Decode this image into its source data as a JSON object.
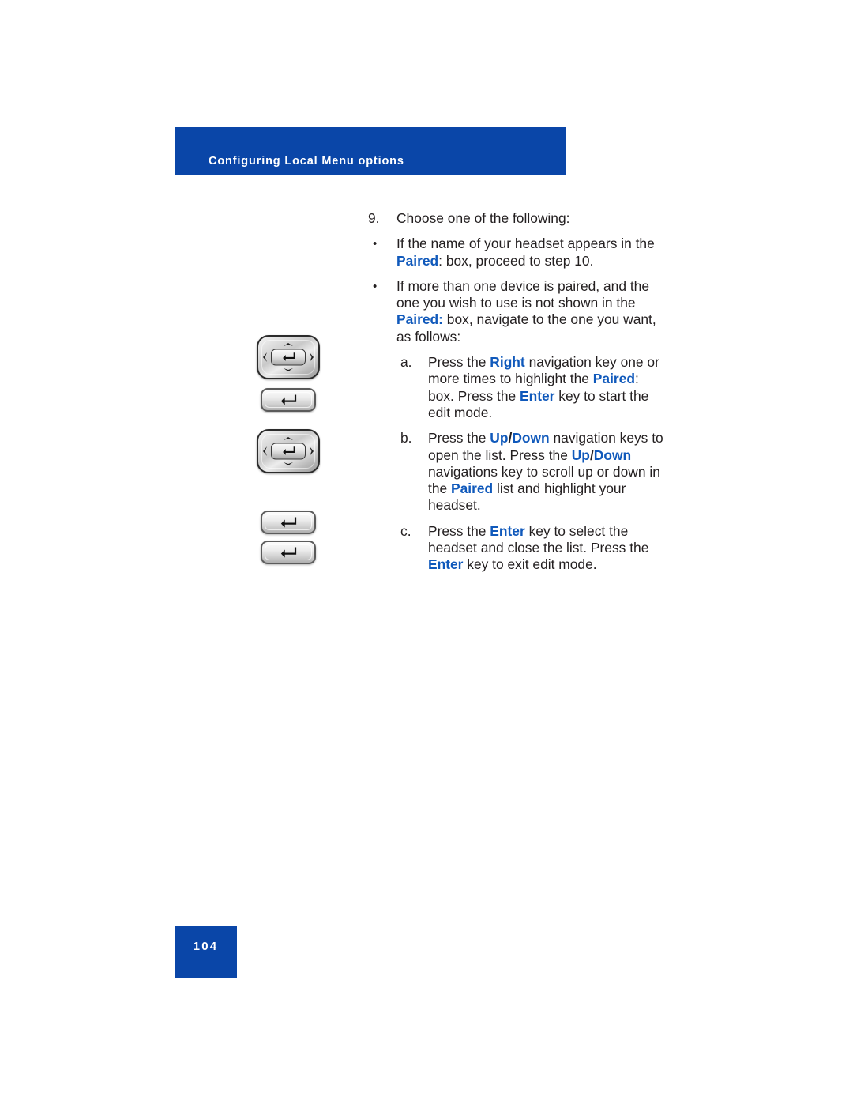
{
  "header": {
    "title": "Configuring Local Menu options",
    "banner_color": "#0a46a8"
  },
  "accent_color": "#1059bb",
  "content": {
    "step": {
      "marker": "9.",
      "text": "Choose one of the following:"
    },
    "bullets": [
      {
        "marker": "•",
        "parts": [
          {
            "t": "If the name of your headset appears in the ",
            "s": "plain"
          },
          {
            "t": "Paired",
            "s": "kw"
          },
          {
            "t": ": box, proceed to step 10.",
            "s": "plain"
          }
        ]
      },
      {
        "marker": "•",
        "parts": [
          {
            "t": "If more than one device is paired, and the one you wish to use is not shown in the ",
            "s": "plain"
          },
          {
            "t": "Paired:",
            "s": "kw"
          },
          {
            "t": " box, navigate to the one you want, as follows:",
            "s": "plain"
          }
        ]
      }
    ],
    "substeps": [
      {
        "marker": "a.",
        "parts": [
          {
            "t": "Press the ",
            "s": "plain"
          },
          {
            "t": "Right",
            "s": "kw"
          },
          {
            "t": " navigation key one or more times to highlight the ",
            "s": "plain"
          },
          {
            "t": "Paired",
            "s": "kw"
          },
          {
            "t": ": box. Press the ",
            "s": "plain"
          },
          {
            "t": "Enter",
            "s": "kw"
          },
          {
            "t": " key to start the edit mode.",
            "s": "plain"
          }
        ]
      },
      {
        "marker": "b.",
        "parts": [
          {
            "t": "Press the ",
            "s": "plain"
          },
          {
            "t": "Up",
            "s": "kw"
          },
          {
            "t": "/",
            "s": "kwplain"
          },
          {
            "t": "Down",
            "s": "kw"
          },
          {
            "t": " navigation keys to open the list. Press the ",
            "s": "plain"
          },
          {
            "t": "Up",
            "s": "kw"
          },
          {
            "t": "/",
            "s": "kwplain"
          },
          {
            "t": "Down",
            "s": "kw"
          },
          {
            "t": " navigations key to scroll up or down in the ",
            "s": "plain"
          },
          {
            "t": "Paired",
            "s": "kw"
          },
          {
            "t": " list and highlight your headset.",
            "s": "plain"
          }
        ]
      },
      {
        "marker": "c.",
        "parts": [
          {
            "t": "Press the ",
            "s": "plain"
          },
          {
            "t": "Enter",
            "s": "kw"
          },
          {
            "t": " key to select the headset and close the list. Press the ",
            "s": "plain"
          },
          {
            "t": "Enter",
            "s": "kw"
          },
          {
            "t": " key to exit edit mode.",
            "s": "plain"
          }
        ]
      }
    ]
  },
  "keys": [
    {
      "type": "navigation-cluster",
      "name": "navigation-key-cluster-a"
    },
    {
      "type": "enter-key",
      "name": "enter-key-a"
    },
    {
      "type": "navigation-cluster",
      "name": "navigation-key-cluster-b"
    },
    {
      "type": "enter-key",
      "name": "enter-key-b"
    },
    {
      "type": "enter-key",
      "name": "enter-key-c"
    }
  ],
  "footer": {
    "page_number": "104"
  }
}
